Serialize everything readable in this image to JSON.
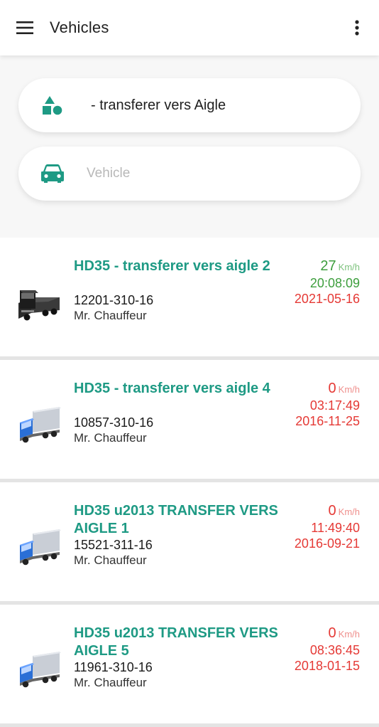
{
  "appbar": {
    "title": "Vehicles"
  },
  "filters": {
    "group_label": "- transferer vers Aigle",
    "vehicle_placeholder": "Vehicle"
  },
  "colors": {
    "accent": "#1e9a84",
    "moving": "#3d9e3d",
    "stopped": "#e53935"
  },
  "vehicles": [
    {
      "name": "HD35 - transferer vers aigle 2",
      "plate": "12201-310-16",
      "driver": "Mr. Chauffeur",
      "speed": "27",
      "unit": "Km/h",
      "time": "20:08:09",
      "date": "2021-05-16",
      "status": "moving",
      "icon": "black-truck-icon"
    },
    {
      "name": "HD35 - transferer vers aigle 4",
      "plate": "10857-310-16",
      "driver": "Mr. Chauffeur",
      "speed": "0",
      "unit": "Km/h",
      "time": "03:17:49",
      "date": "2016-11-25",
      "status": "stopped",
      "icon": "blue-truck-icon"
    },
    {
      "name": "HD35 u2013 TRANSFER VERS AIGLE 1",
      "plate": "15521-311-16",
      "driver": "Mr. Chauffeur",
      "speed": "0",
      "unit": "Km/h",
      "time": "11:49:40",
      "date": "2016-09-21",
      "status": "stopped",
      "icon": "blue-truck-icon"
    },
    {
      "name": "HD35 u2013 TRANSFER VERS AIGLE 5",
      "plate": "11961-310-16",
      "driver": "Mr. Chauffeur",
      "speed": "0",
      "unit": "Km/h",
      "time": "08:36:45",
      "date": "2018-01-15",
      "status": "stopped",
      "icon": "blue-truck-icon"
    }
  ]
}
